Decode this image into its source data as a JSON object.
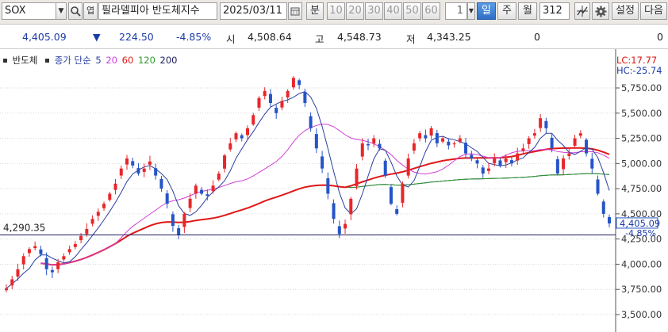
{
  "toolbar": {
    "symbol": "SOX",
    "name": "필라델피아 반도체지수",
    "date": "2025/03/11",
    "period_unit": "분",
    "intervals": [
      "10",
      "20",
      "30",
      "40",
      "50",
      "60"
    ],
    "count": "1",
    "tabs": [
      "일",
      "주",
      "월"
    ],
    "active_tab": "일",
    "bar_count": "312",
    "settings_label": "설정",
    "next_label": "다음"
  },
  "quote": {
    "last": "4,405.09",
    "change_arrow": "▼",
    "change": "224.50",
    "change_pct": "-4.85%",
    "open_label": "시",
    "open": "4,508.64",
    "high_label": "고",
    "high": "4,548.73",
    "low_label": "저",
    "low": "4,343.25",
    "volume": "0",
    "volume2": "0"
  },
  "legend": {
    "name": "반도체",
    "ma_label": "종가 단순",
    "periods": [
      "5",
      "20",
      "60",
      "120",
      "200"
    ]
  },
  "colors": {
    "up": "#e8262a",
    "down": "#2554c7",
    "ma5": "#2a3fa0",
    "ma20": "#d23ed8",
    "ma60": "#e01818",
    "ma120": "#2e9a2e",
    "ma200": "#1c1c5e"
  },
  "chart_data": {
    "type": "candlestick",
    "ylim": [
      3400,
      6000
    ],
    "y_ticks": [
      "5,750.00",
      "5,500.00",
      "5,250.00",
      "5,000.00",
      "4,750.00",
      "4,500.00",
      "4,250.00",
      "4,000.00",
      "3,750.00",
      "3,500.00"
    ],
    "y_tick_values": [
      5750,
      5500,
      5250,
      5000,
      4750,
      4500,
      4250,
      4000,
      3750,
      3500
    ],
    "lc_label": "LC:17.77",
    "hc_label": "HC:-25.74",
    "ref_line_label": "4,290.35",
    "ref_line_value": 4290.35,
    "last_label": "4,405.09",
    "last_value": 4405.09,
    "last_pct_label": "-4.85%",
    "closes": [
      3760,
      3850,
      3950,
      4080,
      4150,
      4180,
      4100,
      3950,
      3920,
      4020,
      4080,
      4150,
      4200,
      4280,
      4350,
      4450,
      4520,
      4600,
      4700,
      4800,
      4950,
      5050,
      4980,
      4900,
      4950,
      5020,
      4880,
      4750,
      4600,
      4380,
      4290,
      4500,
      4650,
      4780,
      4700,
      4680,
      4780,
      4900,
      5080,
      5200,
      5300,
      5250,
      5350,
      5480,
      5650,
      5720,
      5600,
      5500,
      5620,
      5720,
      5850,
      5780,
      5600,
      5350,
      5150,
      4950,
      4700,
      4450,
      4300,
      4400,
      4650,
      4950,
      5200,
      5180,
      5250,
      5150,
      4880,
      4600,
      4500,
      4800,
      5050,
      5200,
      5300,
      5250,
      5350,
      5200,
      5250,
      5180,
      5200,
      5250,
      5100,
      5050,
      5000,
      4900,
      4950,
      5050,
      4980,
      5050,
      5000,
      5100,
      5150,
      5250,
      5300,
      5450,
      5350,
      5150,
      4900,
      5050,
      5100,
      5250,
      5300,
      5100,
      4950,
      4700,
      4500,
      4405
    ]
  }
}
